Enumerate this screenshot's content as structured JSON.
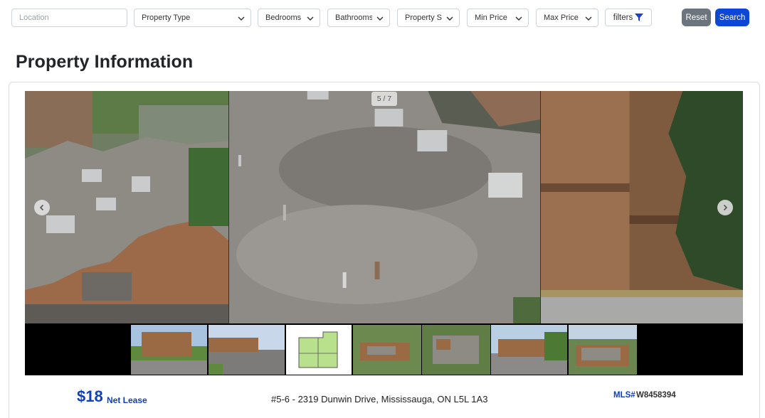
{
  "filters": {
    "location_placeholder": "Location",
    "property_type": "Property Type",
    "bedrooms": "Bedrooms",
    "bathrooms": "Bathrooms",
    "property_status": "Property S",
    "min_price": "Min Price",
    "max_price": "Max Price",
    "filters_label": "filters",
    "reset_label": "Reset",
    "search_label": "Search"
  },
  "page": {
    "title": "Property Information"
  },
  "gallery": {
    "counter": "5 / 7",
    "current_index": 5,
    "total": 7,
    "thumbnails": [
      "building-exterior",
      "parking-lot",
      "floor-plan",
      "aerial-view-1",
      "aerial-view-2",
      "building-side",
      "aerial-view-3"
    ]
  },
  "listing": {
    "price": "$18",
    "price_type": "Net Lease",
    "address": "#5-6 - 2319 Dunwin Drive, Mississauga, ON L5L 1A3",
    "mls_label": "MLS#",
    "mls_number": "W8458394"
  },
  "colors": {
    "accent": "#0d3fbf",
    "search_button": "#0d47d8",
    "reset_button": "#6c757d"
  },
  "icons": {
    "dropdown": "chevron-down-icon",
    "filters": "funnel-icon",
    "prev": "chevron-left-icon",
    "next": "chevron-right-icon"
  }
}
